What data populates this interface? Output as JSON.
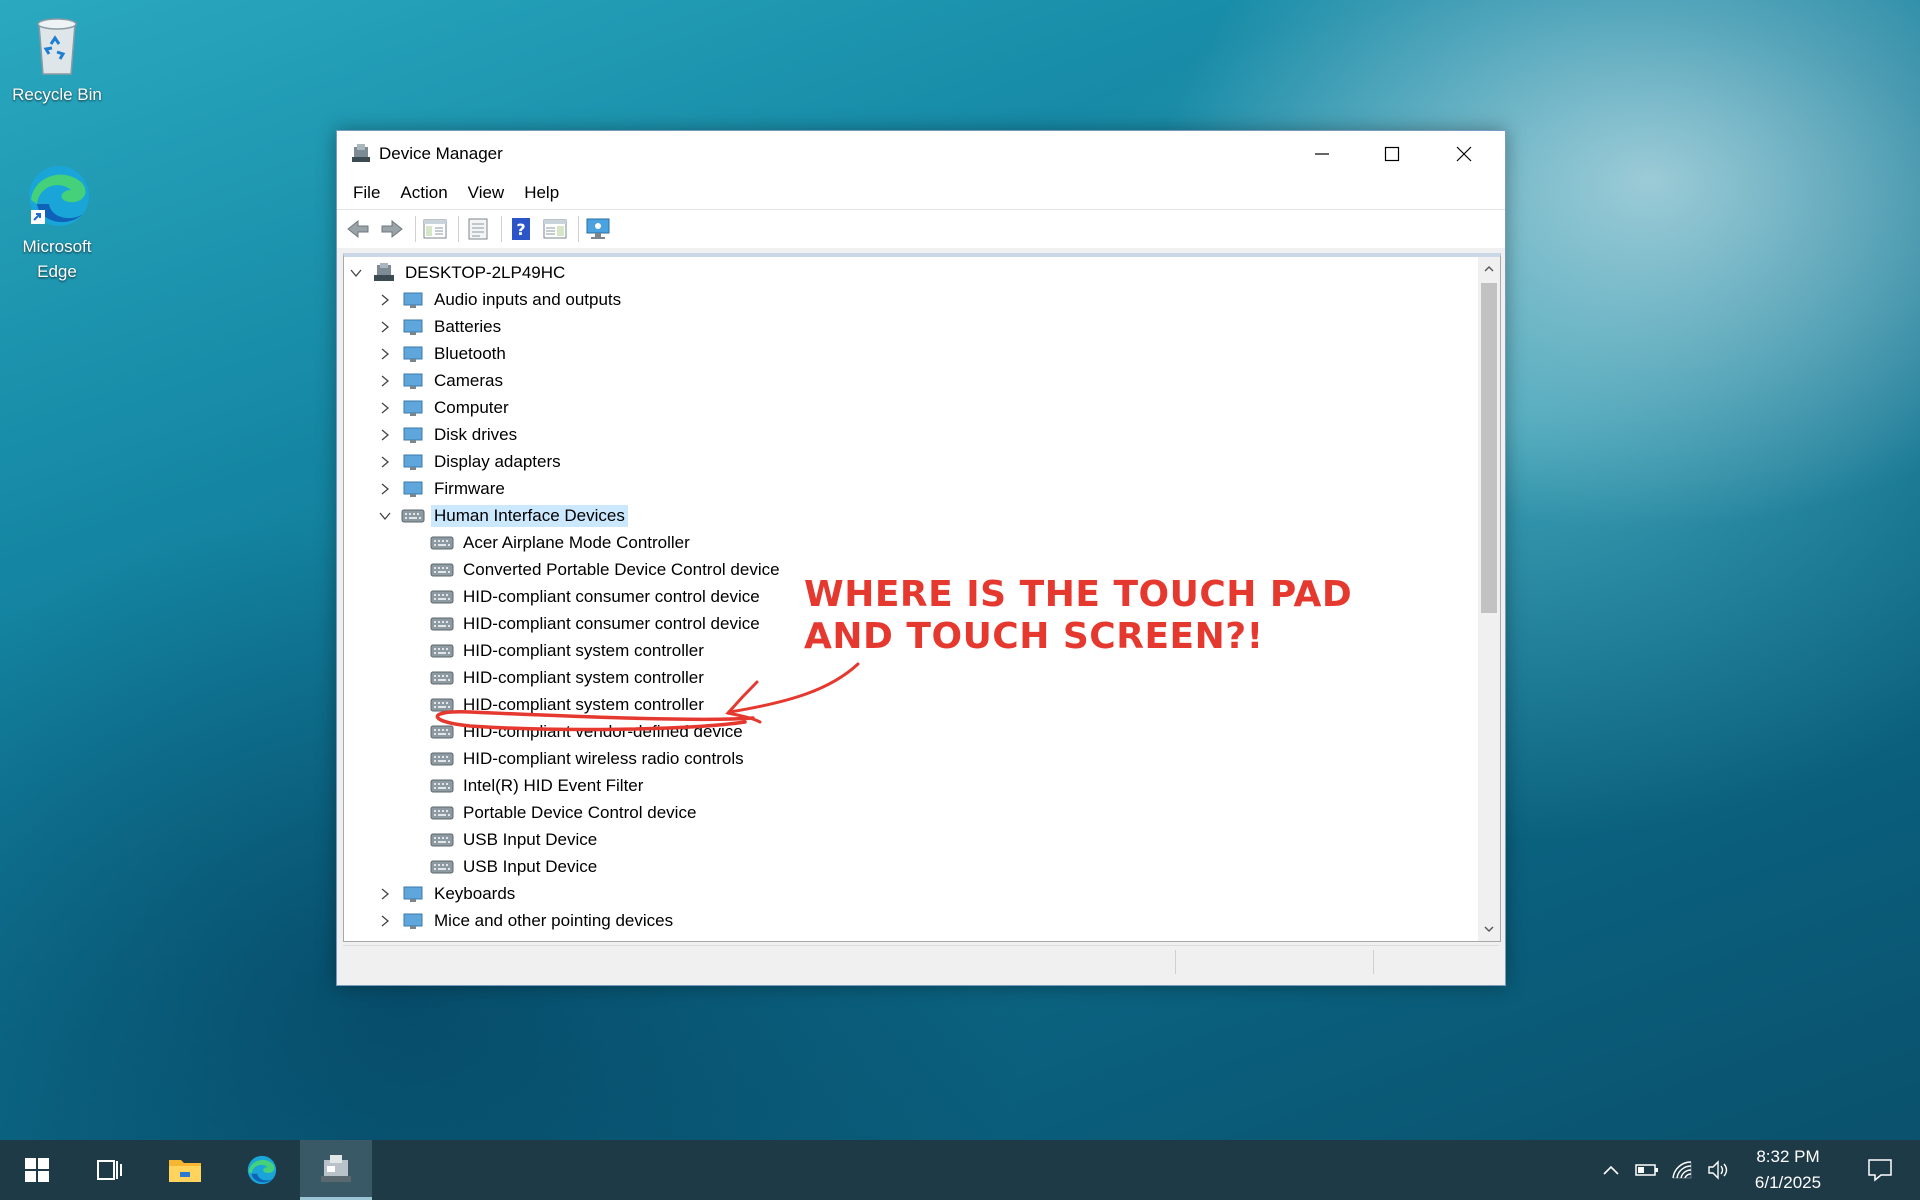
{
  "desktop": {
    "icons": [
      {
        "label": "Recycle Bin"
      },
      {
        "label": "Microsoft Edge"
      }
    ]
  },
  "window": {
    "title": "Device Manager",
    "menu": [
      "File",
      "Action",
      "View",
      "Help"
    ],
    "tree": {
      "root": "DESKTOP-2LP49HC",
      "categories_before": [
        "Audio inputs and outputs",
        "Batteries",
        "Bluetooth",
        "Cameras",
        "Computer",
        "Disk drives",
        "Display adapters",
        "Firmware"
      ],
      "expanded_category": "Human Interface Devices",
      "hid_devices": [
        "Acer Airplane Mode Controller",
        "Converted Portable Device Control device",
        "HID-compliant consumer control device",
        "HID-compliant consumer control device",
        "HID-compliant system controller",
        "HID-compliant system controller",
        "HID-compliant system controller",
        "HID-compliant vendor-defined device",
        "HID-compliant wireless radio controls",
        "Intel(R) HID Event Filter",
        "Portable Device Control device",
        "USB Input Device",
        "USB Input Device"
      ],
      "categories_after": [
        "Keyboards",
        "Mice and other pointing devices"
      ]
    }
  },
  "annotation": {
    "line1": "WHERE IS THE TOUCH PAD",
    "line2": "AND TOUCH SCREEN?!",
    "color": "#e5382f"
  },
  "taskbar": {
    "time": "8:32 PM",
    "date": "6/1/2025"
  },
  "colors": {
    "selection": "#cce8ff",
    "taskbar": "#1e3a46"
  }
}
